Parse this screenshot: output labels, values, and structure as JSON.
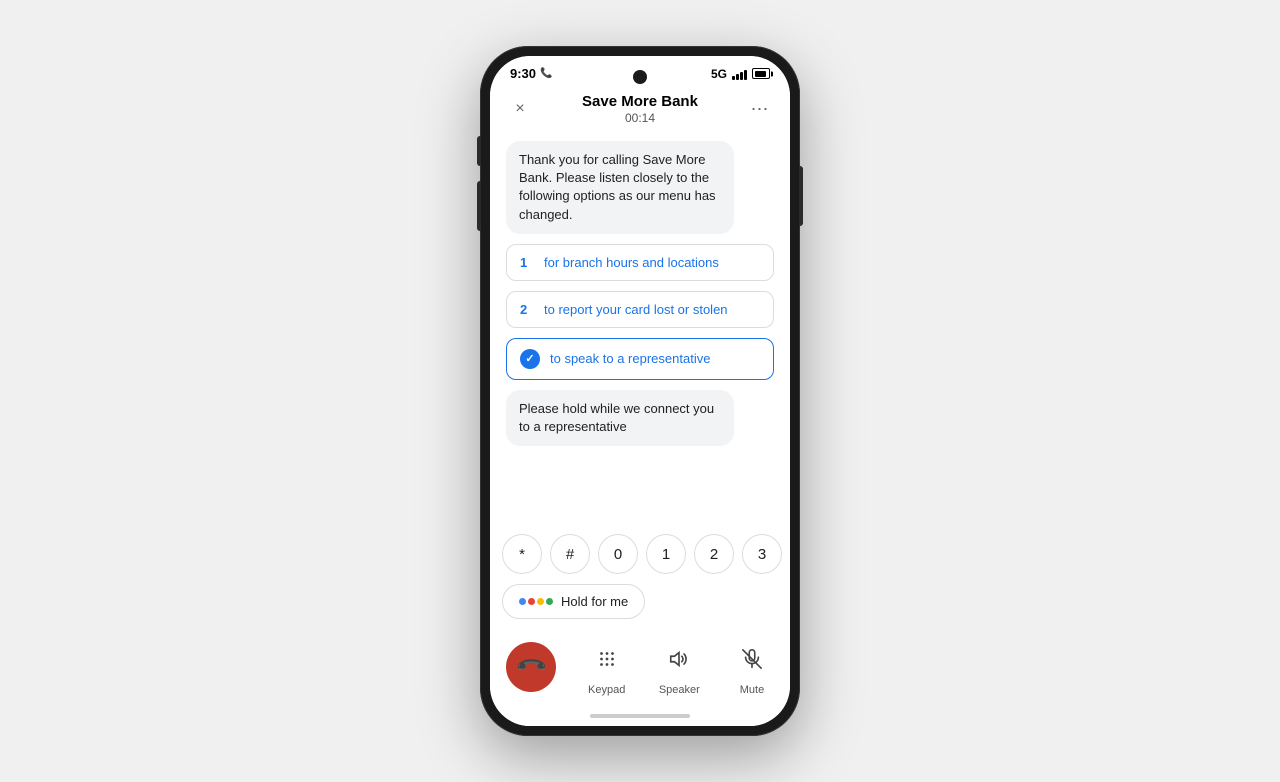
{
  "status_bar": {
    "time": "9:30",
    "network": "5G"
  },
  "call_header": {
    "caller_name": "Save More Bank",
    "duration": "00:14",
    "close_label": "×",
    "more_label": "⋯"
  },
  "chat": {
    "greeting": "Thank you for calling Save More Bank. Please listen closely to the following options as our menu has changed.",
    "option1_number": "1",
    "option1_text": "for branch hours and locations",
    "option2_number": "2",
    "option2_text": "to report your card lost or stolen",
    "option3_text": "to speak to a representative",
    "hold_message": "Please hold while we connect you to a representative"
  },
  "keypad": {
    "keys": [
      "*",
      "#",
      "0",
      "1",
      "2",
      "3"
    ]
  },
  "hold_for_me": {
    "label": "Hold for me"
  },
  "controls": {
    "keypad_label": "Keypad",
    "speaker_label": "Speaker",
    "mute_label": "Mute"
  }
}
